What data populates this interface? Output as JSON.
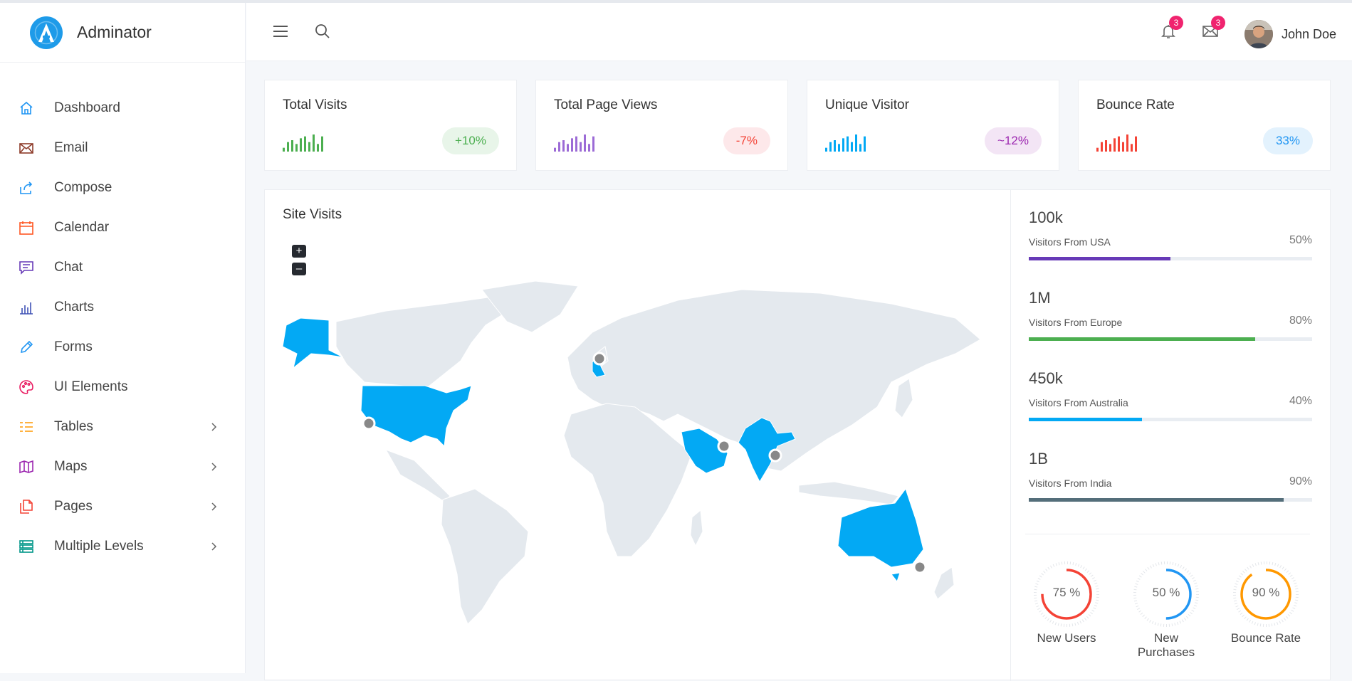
{
  "brand": {
    "name": "Adminator",
    "logo_letter": "A"
  },
  "sidebar": {
    "items": [
      {
        "label": "Dashboard",
        "icon": "home-icon",
        "color": "#2196f3",
        "has_children": false
      },
      {
        "label": "Email",
        "icon": "mail-icon",
        "color": "#8d3b29",
        "has_children": false
      },
      {
        "label": "Compose",
        "icon": "share-icon",
        "color": "#2196f3",
        "has_children": false
      },
      {
        "label": "Calendar",
        "icon": "calendar-icon",
        "color": "#ff5722",
        "has_children": false
      },
      {
        "label": "Chat",
        "icon": "chat-icon",
        "color": "#673ab7",
        "has_children": false
      },
      {
        "label": "Charts",
        "icon": "bar-chart-icon",
        "color": "#3f51b5",
        "has_children": false
      },
      {
        "label": "Forms",
        "icon": "pencil-icon",
        "color": "#2196f3",
        "has_children": false
      },
      {
        "label": "UI Elements",
        "icon": "palette-icon",
        "color": "#e91e63",
        "has_children": false
      },
      {
        "label": "Tables",
        "icon": "list-icon",
        "color": "#ff9800",
        "has_children": true
      },
      {
        "label": "Maps",
        "icon": "map-icon",
        "color": "#9c27b0",
        "has_children": true
      },
      {
        "label": "Pages",
        "icon": "files-icon",
        "color": "#f44336",
        "has_children": true
      },
      {
        "label": "Multiple Levels",
        "icon": "layers-icon",
        "color": "#009688",
        "has_children": true
      }
    ]
  },
  "topbar": {
    "notifications_count": "3",
    "messages_count": "3",
    "user_name": "John Doe"
  },
  "stats": [
    {
      "title": "Total Visits",
      "change": "+10%",
      "color": "#4caf50",
      "pill_bg": "#e8f5e9",
      "spark": [
        2,
        5,
        6,
        4,
        7,
        8,
        5,
        9,
        4,
        8
      ]
    },
    {
      "title": "Total Page Views",
      "change": "-7%",
      "color": "#9c6bd6",
      "pill_bg": "#fde8ea",
      "pill_color": "#f44336",
      "spark": [
        2,
        5,
        6,
        4,
        7,
        8,
        5,
        9,
        4,
        8
      ]
    },
    {
      "title": "Unique Visitor",
      "change": "~12%",
      "color": "#03a9f4",
      "pill_bg": "#f3e5f5",
      "pill_color": "#9c27b0",
      "spark": [
        2,
        5,
        6,
        4,
        7,
        8,
        5,
        9,
        4,
        8
      ]
    },
    {
      "title": "Bounce Rate",
      "change": "33%",
      "color": "#f44336",
      "pill_bg": "#e3f2fd",
      "pill_color": "#2196f3",
      "spark": [
        2,
        5,
        6,
        4,
        7,
        8,
        5,
        9,
        4,
        8
      ]
    }
  ],
  "site_visits": {
    "title": "Site Visits",
    "zoom_in": "+",
    "zoom_out": "–",
    "highlight_color": "#03a9f4",
    "base_color": "#e4e9ee"
  },
  "regions": [
    {
      "value": "100k",
      "label": "Visitors From USA",
      "percent_text": "50%",
      "percent": 50,
      "color": "#673ab7"
    },
    {
      "value": "1M",
      "label": "Visitors From Europe",
      "percent_text": "80%",
      "percent": 80,
      "color": "#4caf50"
    },
    {
      "value": "450k",
      "label": "Visitors From Australia",
      "percent_text": "40%",
      "percent": 40,
      "color": "#03a9f4"
    },
    {
      "value": "1B",
      "label": "Visitors From India",
      "percent_text": "90%",
      "percent": 90,
      "color": "#546e7a"
    }
  ],
  "donuts": [
    {
      "text": "75 %",
      "label": "New Users",
      "percent": 75,
      "color": "#f44336"
    },
    {
      "text": "50 %",
      "label": "New Purchases",
      "percent": 50,
      "color": "#2196f3"
    },
    {
      "text": "90 %",
      "label": "Bounce Rate",
      "percent": 90,
      "color": "#ff9800"
    }
  ]
}
